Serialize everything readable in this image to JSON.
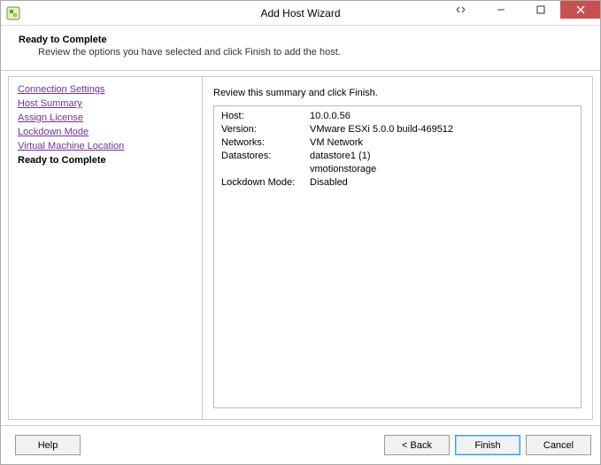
{
  "titlebar": {
    "title": "Add Host Wizard"
  },
  "header": {
    "title": "Ready to Complete",
    "subtitle": "Review the options you have selected and click Finish to add the host."
  },
  "steps": {
    "items": [
      "Connection Settings",
      "Host Summary",
      "Assign License",
      "Lockdown Mode",
      "Virtual Machine Location"
    ],
    "current": "Ready to Complete"
  },
  "content": {
    "instruction": "Review this summary and click Finish.",
    "summary": {
      "host_label": "Host:",
      "host_value": "10.0.0.56",
      "version_label": "Version:",
      "version_value": "VMware ESXi 5.0.0 build-469512",
      "networks_label": "Networks:",
      "networks_value": "VM Network",
      "datastores_label": "Datastores:",
      "datastores_value1": "datastore1 (1)",
      "datastores_value2": "vmotionstorage",
      "lockdown_label": "Lockdown Mode:",
      "lockdown_value": "Disabled"
    }
  },
  "footer": {
    "help": "Help",
    "back": "< Back",
    "finish": "Finish",
    "cancel": "Cancel"
  }
}
